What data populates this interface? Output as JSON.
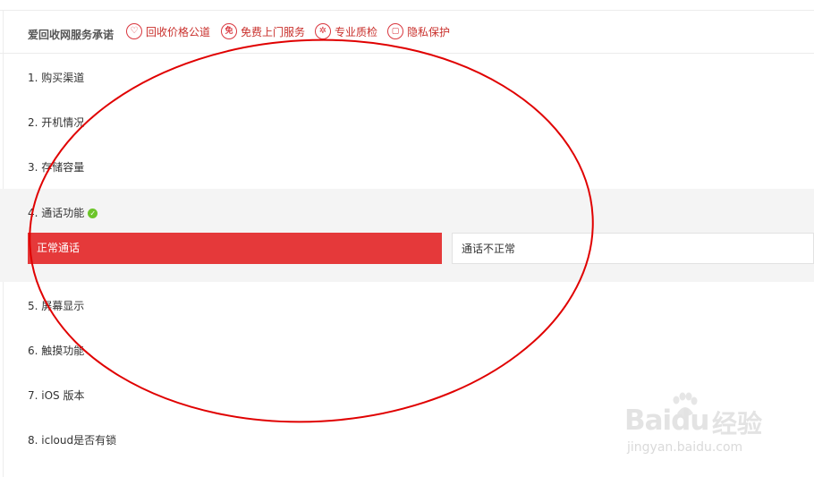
{
  "promise": {
    "title": "爱回收网服务承诺",
    "items": [
      {
        "icon": "heart-icon",
        "glyph": "♡",
        "label": "回收价格公道"
      },
      {
        "icon": "free-icon",
        "glyph": "免",
        "label": "免费上门服务"
      },
      {
        "icon": "gear-icon",
        "glyph": "✲",
        "label": "专业质检"
      },
      {
        "icon": "privacy-icon",
        "glyph": "▢",
        "label": "隐私保护"
      }
    ]
  },
  "questions": [
    {
      "label": "1. 购买渠道"
    },
    {
      "label": "2. 开机情况"
    },
    {
      "label": "3. 存储容量"
    },
    {
      "label": "4. 通话功能",
      "answered": true,
      "options": [
        "正常通话",
        "通话不正常"
      ],
      "selected": "正常通话"
    },
    {
      "label": "5. 屏幕显示"
    },
    {
      "label": "6. 触摸功能"
    },
    {
      "label": "7. iOS 版本"
    },
    {
      "label": "8. icloud是否有锁"
    }
  ],
  "watermark": {
    "brand": "Baidu",
    "product": "经验",
    "url": "jingyan.baidu.com"
  },
  "colors": {
    "accent": "#e5393a",
    "promise_text": "#c9302c",
    "check_green": "#6cc52a",
    "annotation_red": "#e00000"
  }
}
